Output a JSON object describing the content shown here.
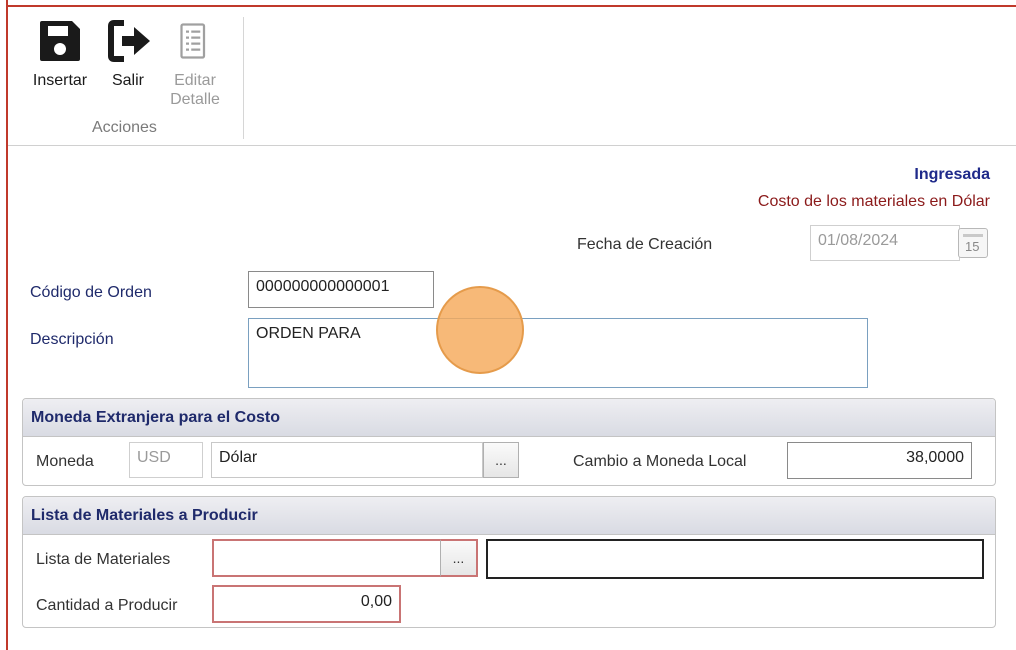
{
  "ribbon": {
    "buttons": [
      {
        "label": "Insertar",
        "icon": "save-icon",
        "enabled": true
      },
      {
        "label": "Salir",
        "icon": "exit-icon",
        "enabled": true
      },
      {
        "label_line1": "Editar",
        "label_line2": "Detalle",
        "icon": "notebook-icon",
        "enabled": false
      }
    ],
    "group_label": "Acciones"
  },
  "header": {
    "status": "Ingresada",
    "cost_info": "Costo de los materiales en Dólar",
    "creation_date_label": "Fecha de Creación",
    "creation_date": "01/08/2024",
    "calendar_day": "15"
  },
  "order": {
    "code_label": "Código de Orden",
    "code_value": "000000000000001",
    "description_label": "Descripción",
    "description_value": "ORDEN PARA"
  },
  "currency_panel": {
    "title": "Moneda Extranjera para el Costo",
    "currency_label": "Moneda",
    "currency_code": "USD",
    "currency_name": "Dólar",
    "lookup_button": "...",
    "exchange_label": "Cambio a Moneda Local",
    "exchange_value": "38,0000"
  },
  "materials_panel": {
    "title": "Lista de Materiales a Producir",
    "list_label": "Lista de Materiales",
    "list_code": "",
    "lookup_button": "...",
    "list_description": "",
    "quantity_label": "Cantidad a Producir",
    "quantity_value": "0,00"
  },
  "colors": {
    "accent_blue": "#1f2a8a",
    "error_red": "#c97474",
    "cost_red": "#8b1a1a",
    "cursor": "#f5aa5a"
  }
}
